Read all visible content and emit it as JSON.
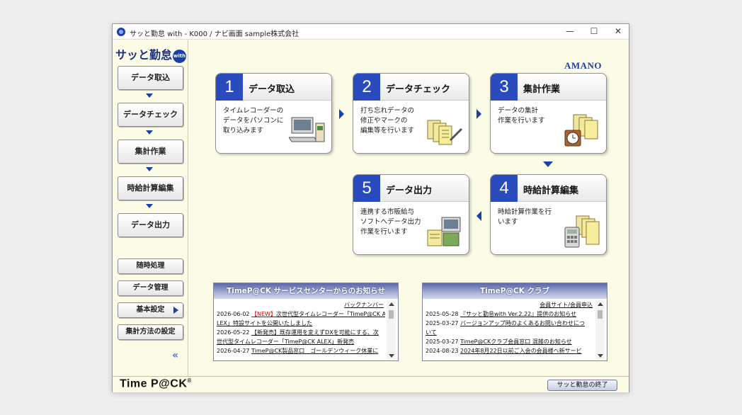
{
  "window": {
    "title": "サッと勤怠 with - K000 / ナビ画面   sample株式会社",
    "minimize": "—",
    "maximize": "☐",
    "close": "✕"
  },
  "sidebar": {
    "logo_text": "サッと勤怠",
    "logo_badge": "with",
    "steps": [
      "データ取込",
      "データチェック",
      "集計作業",
      "時給計算編集",
      "データ出力"
    ],
    "sub_buttons": [
      "随時処理",
      "データ管理",
      "基本設定",
      "集計方法の設定"
    ],
    "collapse": "«"
  },
  "brand": "AMANO",
  "cards": [
    {
      "num": "1",
      "title": "データ取込",
      "desc": "タイムレコーダーの\nデータをパソコンに\n取り込みます",
      "art": "computer-icon"
    },
    {
      "num": "2",
      "title": "データチェック",
      "desc": "打ち忘れデータの\n修正やマークの\n編集等を行います",
      "art": "documents-pen-icon"
    },
    {
      "num": "3",
      "title": "集計作業",
      "desc": "データの集計\n作業を行います",
      "art": "documents-clock-icon"
    },
    {
      "num": "4",
      "title": "時給計算編集",
      "desc": "時給計算作業を行\nいます",
      "art": "documents-calculator-icon"
    },
    {
      "num": "5",
      "title": "データ出力",
      "desc": "連携する市販給与\nソフトへデータ出力\n作業を行います",
      "art": "export-computer-icon"
    }
  ],
  "news_service": {
    "header": "TimeP@CK サービスセンターからのお知らせ",
    "backlink": "バックナンバー",
    "items": [
      {
        "date": "2026-06-02",
        "tag": "【NEW】",
        "text": "次世代型タイムレコーダー「TimeP@CK A"
      },
      {
        "date": "",
        "tag": "",
        "text": "LEX」特設サイトを公開いたしました"
      },
      {
        "date": "2026-05-22",
        "tag": "",
        "text": "【新発売】既存運用を変えずDXを可能にする、次"
      },
      {
        "date": "",
        "tag": "",
        "text": "世代型タイムレコーダー「TimeP@CK ALEX」新発売"
      },
      {
        "date": "2026-04-27",
        "tag": "",
        "text": "TimeP@CK製品窓口　ゴールデンウィーク休業に"
      }
    ]
  },
  "news_club": {
    "header": "TimeP@CK クラブ",
    "backlink": "会員サイト/会員申込",
    "items": [
      {
        "date": "2025-05-28",
        "text": "『サッと勤怠with Ver.2.22』提供のお知らせ"
      },
      {
        "date": "2025-03-27",
        "text": "バージョンアップ時のよくあるお問い合わせにつ"
      },
      {
        "date": "",
        "text": "いて"
      },
      {
        "date": "2025-03-27",
        "text": "TimeP@CKクラブ会員窓口 混雑のお知らせ"
      },
      {
        "date": "2024-08-23",
        "text": "2024年8月22日以前ご入会の会員様へ新サービ"
      }
    ]
  },
  "footer": {
    "logo": "Time P@CK",
    "logo_mark": "®",
    "exit_button": "サッと勤怠の終了"
  },
  "colors": {
    "accent": "#1a3fa8",
    "number_block": "#2a4bbd",
    "background": "#fbfbe6",
    "news_tag": "#d00000"
  }
}
